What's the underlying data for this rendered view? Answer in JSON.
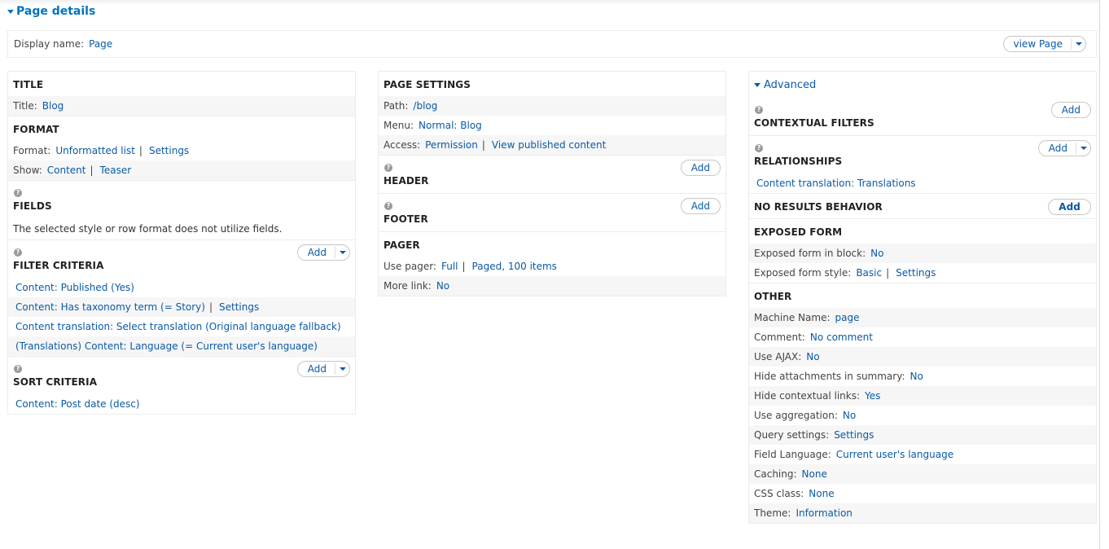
{
  "header": {
    "section_toggle": "Page details",
    "display_name_label": "Display name:",
    "display_name_value": "Page",
    "view_button": "view Page"
  },
  "left": {
    "title": {
      "heading": "TITLE",
      "rows": [
        {
          "label": "Title:",
          "value": "Blog"
        }
      ]
    },
    "format": {
      "heading": "FORMAT",
      "format_label": "Format:",
      "format_value": "Unformatted list",
      "format_settings": "Settings",
      "show_label": "Show:",
      "show_value": "Content",
      "show_settings": "Teaser"
    },
    "fields": {
      "heading": "FIELDS",
      "note": "The selected style or row format does not utilize fields."
    },
    "filter_criteria": {
      "heading": "FILTER CRITERIA",
      "add_label": "Add",
      "items": [
        "Content: Published (Yes)",
        "Content: Has taxonomy term (= Story)",
        "Content translation: Select translation (Original language fallback)",
        "(Translations) Content: Language (= Current user's language)"
      ],
      "item2_settings": "Settings"
    },
    "sort_criteria": {
      "heading": "SORT CRITERIA",
      "add_label": "Add",
      "items": [
        "Content: Post date (desc)"
      ]
    }
  },
  "middle": {
    "page_settings": {
      "heading": "PAGE SETTINGS",
      "path_label": "Path:",
      "path_value": "/blog",
      "menu_label": "Menu:",
      "menu_value": "Normal: Blog",
      "access_label": "Access:",
      "access_value": "Permission",
      "access_detail": "View published content"
    },
    "header": {
      "heading": "HEADER",
      "add_label": "Add"
    },
    "footer": {
      "heading": "FOOTER",
      "add_label": "Add"
    },
    "pager": {
      "heading": "PAGER",
      "use_pager_label": "Use pager:",
      "use_pager_value": "Full",
      "use_pager_detail": "Paged, 100 items",
      "more_link_label": "More link:",
      "more_link_value": "No"
    }
  },
  "right": {
    "advanced_toggle": "Advanced",
    "contextual_filters": {
      "heading": "CONTEXTUAL FILTERS",
      "add_label": "Add"
    },
    "relationships": {
      "heading": "RELATIONSHIPS",
      "add_label": "Add",
      "items": [
        "Content translation: Translations"
      ]
    },
    "no_results": {
      "heading": "NO RESULTS BEHAVIOR",
      "add_label": "Add"
    },
    "exposed_form": {
      "heading": "EXPOSED FORM",
      "block_label": "Exposed form in block:",
      "block_value": "No",
      "style_label": "Exposed form style:",
      "style_value": "Basic",
      "style_settings": "Settings"
    },
    "other": {
      "heading": "OTHER",
      "rows": [
        {
          "label": "Machine Name:",
          "value": "page"
        },
        {
          "label": "Comment:",
          "value": "No comment"
        },
        {
          "label": "Use AJAX:",
          "value": "No"
        },
        {
          "label": "Hide attachments in summary:",
          "value": "No"
        },
        {
          "label": "Hide contextual links:",
          "value": "Yes"
        },
        {
          "label": "Use aggregation:",
          "value": "No"
        },
        {
          "label": "Query settings:",
          "value": "Settings"
        },
        {
          "label": "Field Language:",
          "value": "Current user's language"
        },
        {
          "label": "Caching:",
          "value": "None"
        },
        {
          "label": "CSS class:",
          "value": "None"
        },
        {
          "label": "Theme:",
          "value": "Information"
        }
      ]
    }
  },
  "colors": {
    "link": "#0a5aa6",
    "toggle": "#0074bd",
    "row_alt": "#f6f6f6",
    "border": "#ececec"
  }
}
